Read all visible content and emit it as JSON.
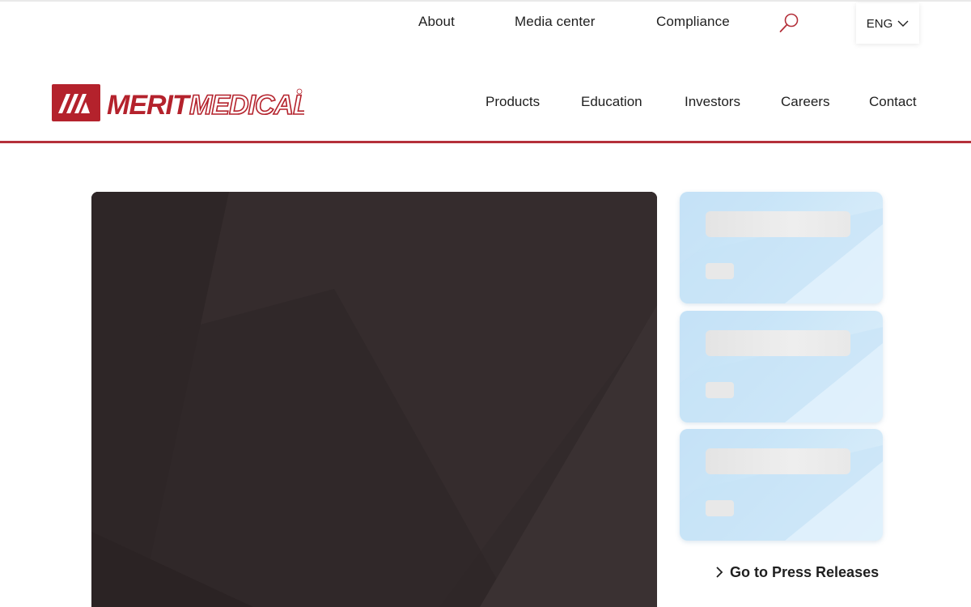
{
  "utility_nav": {
    "about": "About",
    "media_center": "Media center",
    "compliance": "Compliance",
    "search_icon": "search-icon",
    "language": "ENG"
  },
  "brand": {
    "name": "MERIT MEDICAL",
    "color": "#b4222c"
  },
  "main_nav": {
    "items": [
      "Products",
      "Education",
      "Investors",
      "Careers",
      "Contact"
    ]
  },
  "press": {
    "cards": [
      {
        "state": "loading"
      },
      {
        "state": "loading"
      },
      {
        "state": "loading"
      }
    ],
    "link_label": "Go to Press Releases"
  },
  "colors": {
    "accent": "#b4303a",
    "hero_bg": "#322a2b",
    "card_bg": "#cde7f8"
  }
}
